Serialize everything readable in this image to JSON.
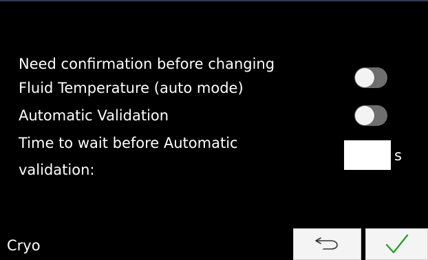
{
  "footer": {
    "screen_name": "Cryo"
  },
  "settings": {
    "confirm_line1": "Need confirmation before changing",
    "confirm_line2": "Fluid Temperature (auto mode)",
    "confirm_toggle_state": "off",
    "auto_validation_label": "Automatic Validation",
    "auto_validation_toggle_state": "off",
    "wait_time_line1": "Time to wait before Automatic",
    "wait_time_line2": "validation:",
    "wait_time_value": "",
    "wait_time_unit": "s"
  },
  "buttons": {
    "back_icon": "return-arrow-icon",
    "confirm_icon": "checkmark-icon"
  },
  "colors": {
    "background": "#000000",
    "text": "#ffffff",
    "toggle_track": "#6e6e6e",
    "toggle_knob": "#f3f3f3",
    "checkmark": "#2aa02a",
    "button_background": "#f4f4f4"
  }
}
